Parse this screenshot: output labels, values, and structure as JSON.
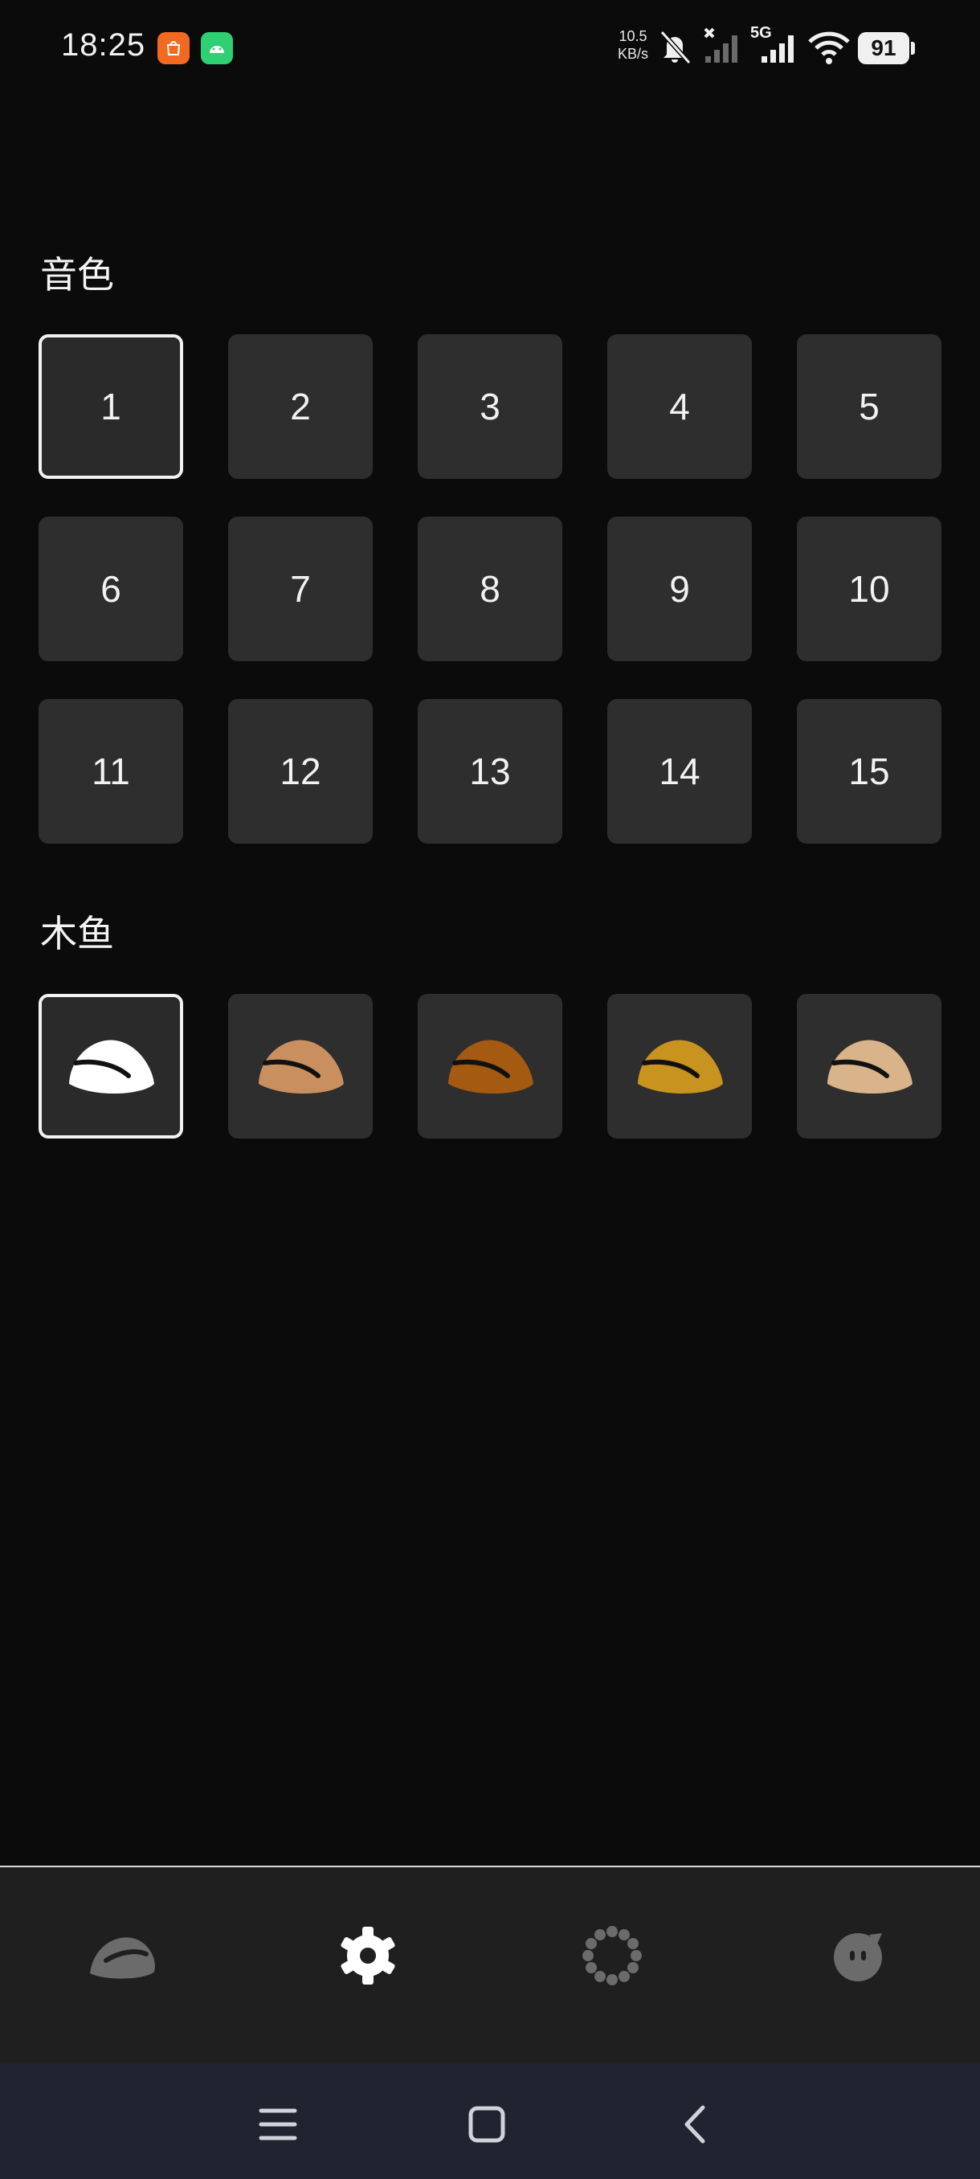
{
  "status_bar": {
    "time": "18:25",
    "net_speed_value": "10.5",
    "net_speed_unit": "KB/s",
    "network_type": "5G",
    "battery": "91"
  },
  "sections": {
    "timbre": {
      "title": "音色",
      "tiles": [
        "1",
        "2",
        "3",
        "4",
        "5",
        "6",
        "7",
        "8",
        "9",
        "10",
        "11",
        "12",
        "13",
        "14",
        "15"
      ],
      "selected_index": 0
    },
    "muyu": {
      "title": "木鱼",
      "styles": [
        {
          "name": "white-muyu-icon",
          "color": "#ffffff"
        },
        {
          "name": "light-wood-muyu-icon",
          "color": "#c98f5f"
        },
        {
          "name": "dark-wood-muyu-icon",
          "color": "#a45a10"
        },
        {
          "name": "golden-muyu-icon",
          "color": "#c8931f"
        },
        {
          "name": "beige-muyu-icon",
          "color": "#d9b38a"
        }
      ],
      "selected_index": 0
    }
  },
  "tabbar": {
    "tabs": [
      {
        "name": "muyu-tab-icon",
        "active": false
      },
      {
        "name": "settings-tab-icon",
        "active": true
      },
      {
        "name": "beads-tab-icon",
        "active": false
      },
      {
        "name": "face-tab-icon",
        "active": false
      }
    ],
    "active_color": "#ffffff",
    "inactive_color": "#6b6b6b"
  },
  "system_nav": {
    "buttons": [
      "menu-icon",
      "home-icon",
      "back-icon"
    ]
  }
}
